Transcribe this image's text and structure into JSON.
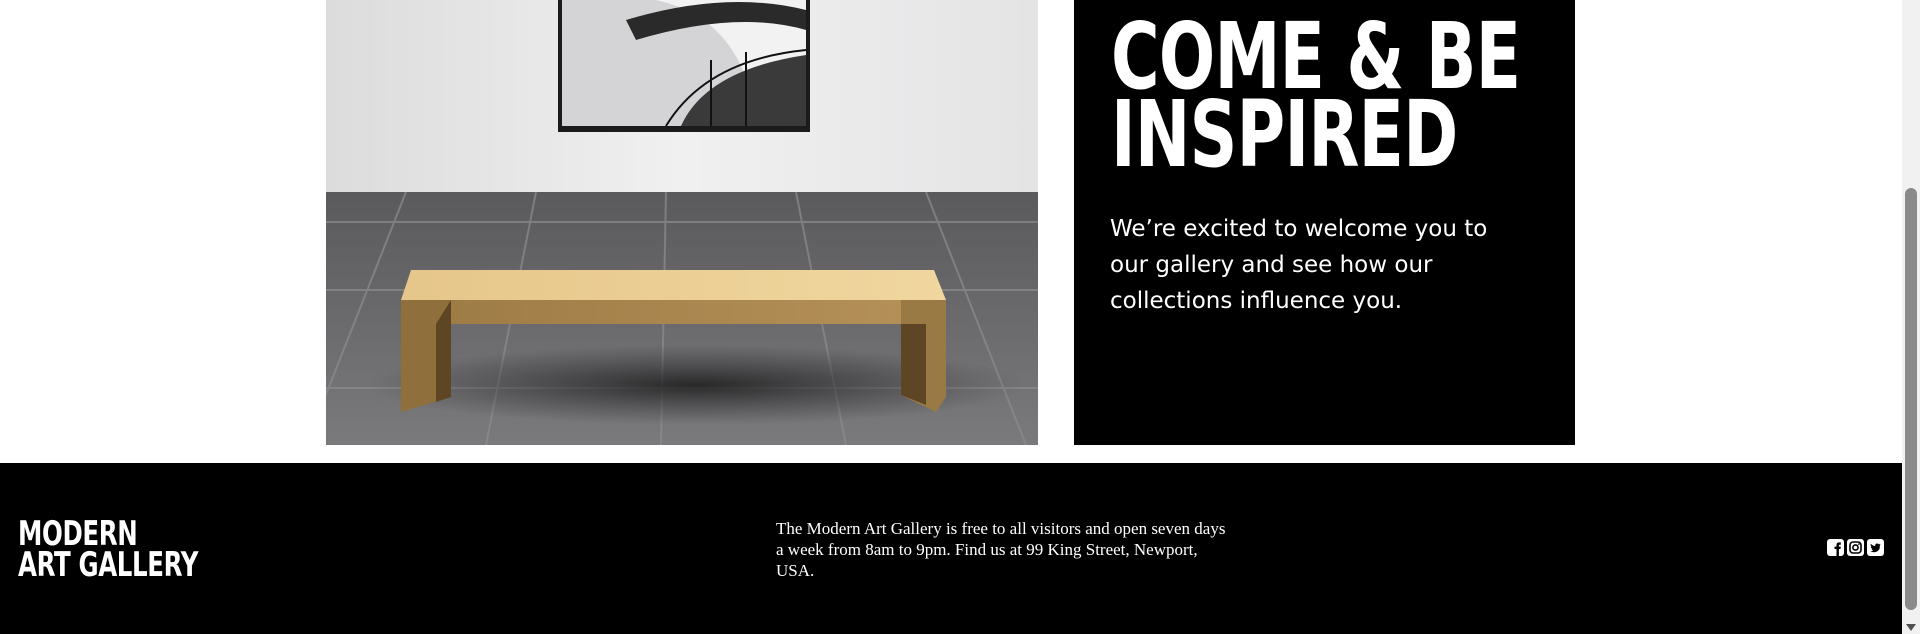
{
  "promo": {
    "heading_line1": "COME & BE",
    "heading_line2": "INSPIRED",
    "body": "We’re excited to welcome you to our gallery and see how our collections influence you."
  },
  "footer": {
    "logo_line1": "MODERN",
    "logo_line2": "ART GALLERY",
    "info": "The Modern Art Gallery is free to all visitors and open seven days a week from 8am to 9pm. Find us at 99 King Street, Newport, USA.",
    "social_icons": [
      "facebook-icon",
      "instagram-icon",
      "twitter-icon"
    ]
  },
  "colors": {
    "background": "#ffffff",
    "panel": "#000000",
    "text_on_dark": "#ffffff",
    "bench": "#d9b676"
  }
}
